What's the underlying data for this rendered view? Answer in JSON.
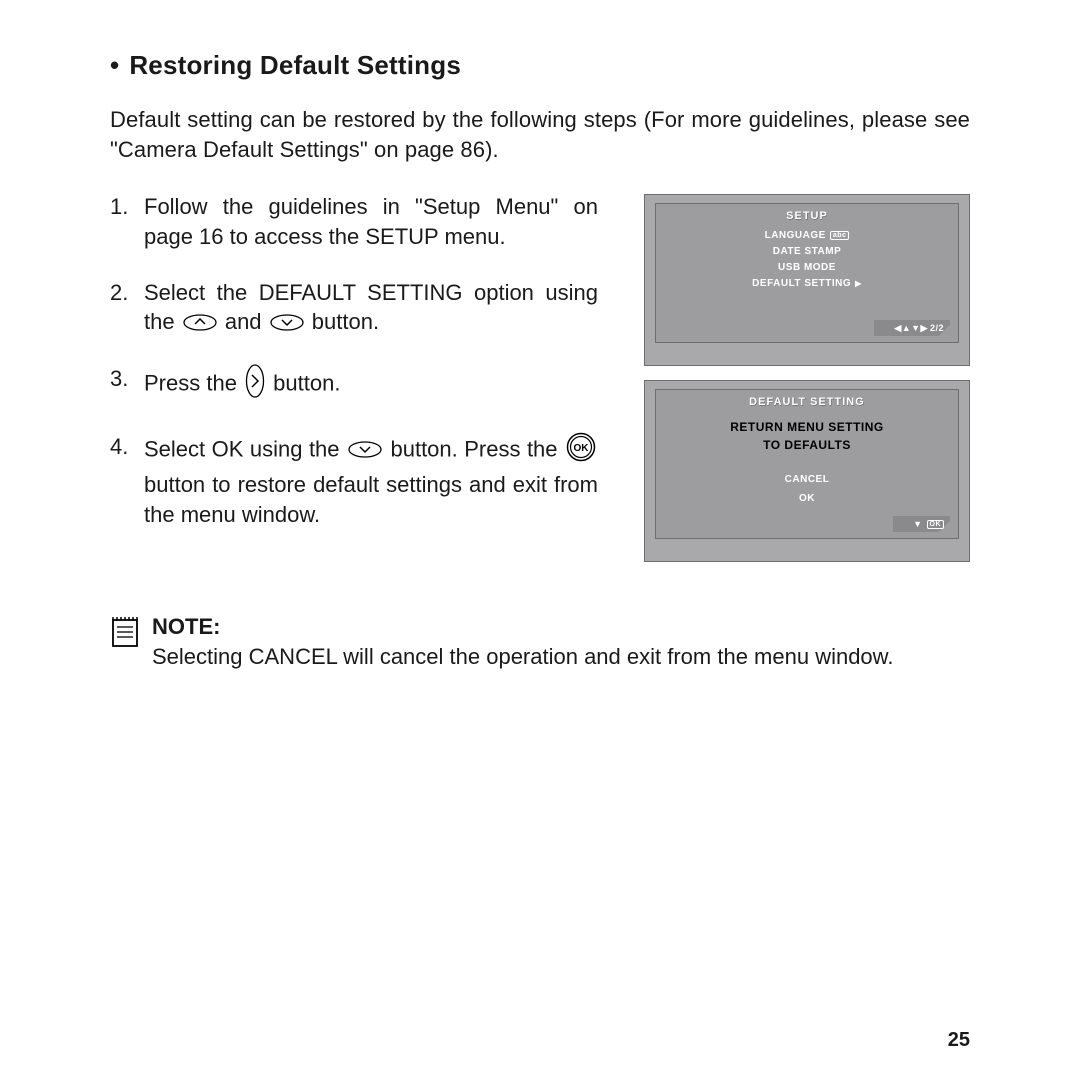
{
  "heading": "Restoring Default Settings",
  "intro": "Default setting can be restored by the following steps (For more guidelines, please see \"Camera Default Settings\" on page 86).",
  "steps": {
    "s1": "Follow the guidelines in \"Setup Menu\" on page 16 to access the SETUP menu.",
    "s2a": "Select the DEFAULT SETTING option using the ",
    "s2b": " and ",
    "s2c": " button.",
    "s3a": "Press the ",
    "s3b": " button.",
    "s4a": "Select OK using the ",
    "s4b": " button. Press the ",
    "s4c": " button to restore default settings and exit from the menu window."
  },
  "screen1": {
    "title": "SETUP",
    "item1": "LANGUAGE",
    "abc": "abc",
    "item2": "DATE STAMP",
    "item3": "USB MODE",
    "item4": "DEFAULT SETTING",
    "footer": "2/2"
  },
  "screen2": {
    "title": "DEFAULT SETTING",
    "line1": "RETURN MENU SETTING",
    "line2": "TO DEFAULTS",
    "opt1": "CANCEL",
    "opt2": "OK",
    "footerOk": "OK"
  },
  "note": {
    "label": "NOTE:",
    "text": "Selecting CANCEL will cancel the operation and exit from the menu window."
  },
  "pageNumber": "25"
}
